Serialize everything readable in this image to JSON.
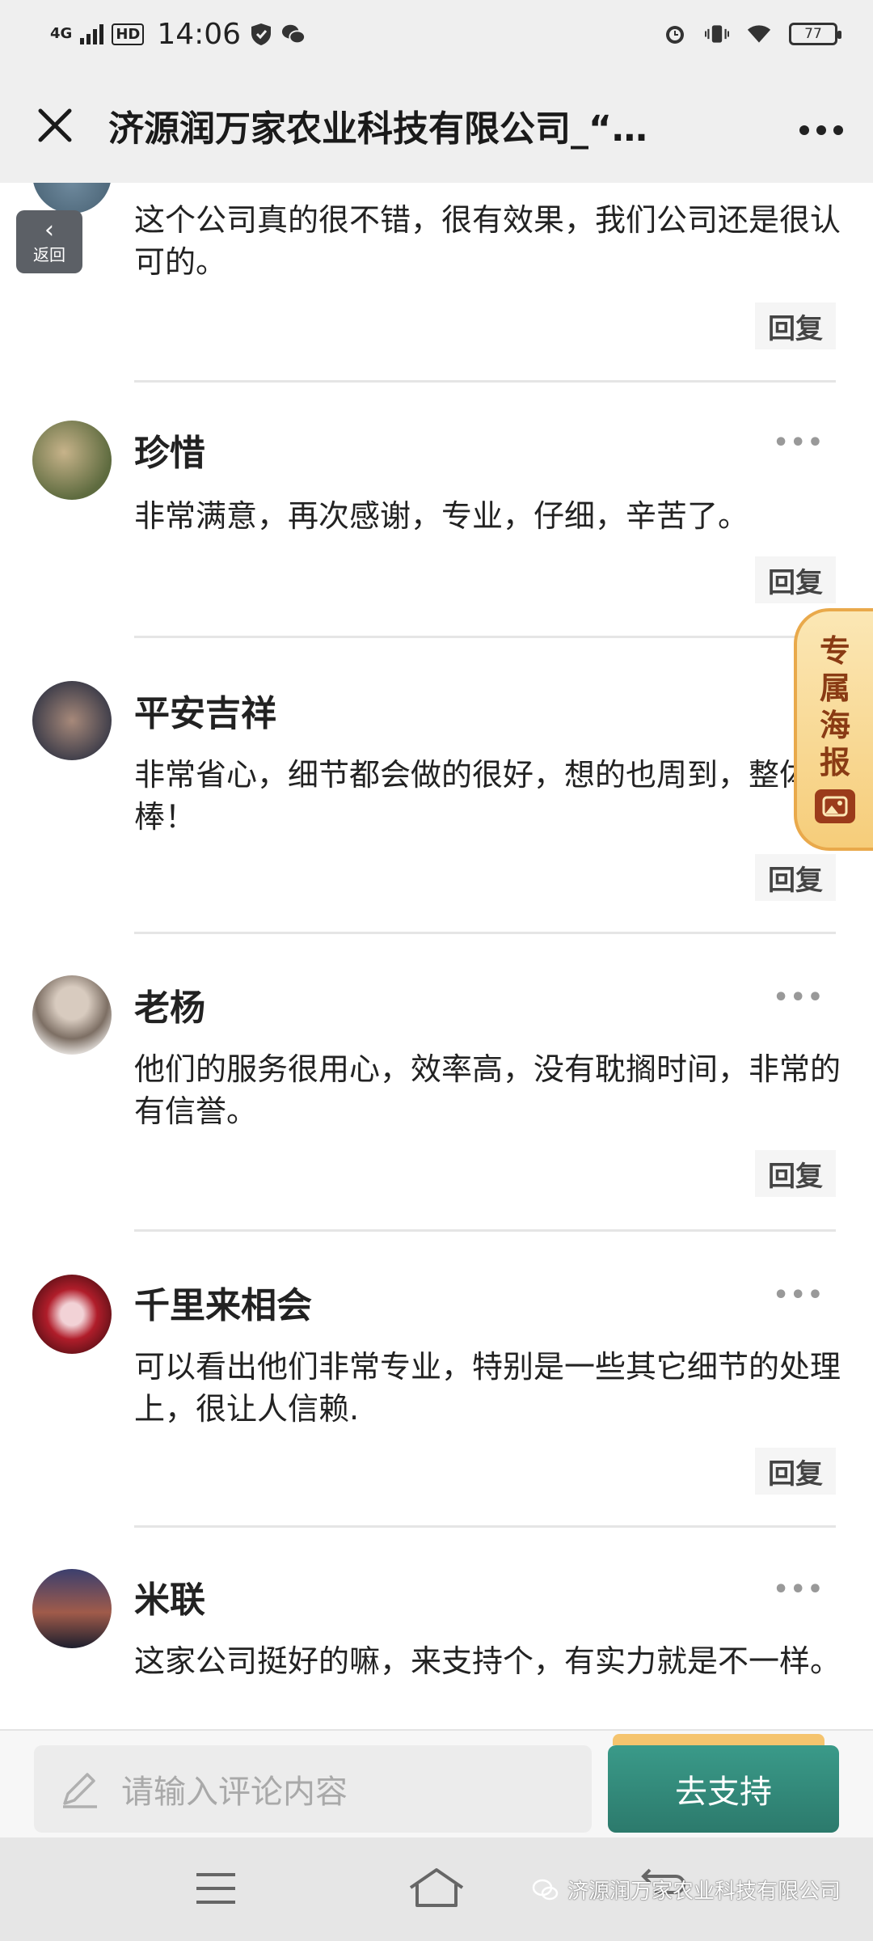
{
  "status_bar": {
    "network": "4G",
    "hd": "HD",
    "time": "14:06",
    "battery": "77"
  },
  "header": {
    "title": "济源润万家农业科技有限公司_“…"
  },
  "back_float": {
    "label": "返回"
  },
  "poster": {
    "label": "专属海报"
  },
  "comments": [
    {
      "name": "",
      "text": "这个公司真的很不错，很有效果，我们公司还是很认可的。",
      "reply": "回复"
    },
    {
      "name": "珍惜",
      "text": "非常满意，再次感谢，专业，仔细，辛苦了。",
      "reply": "回复"
    },
    {
      "name": "平安吉祥",
      "text": "非常省心，细节都会做的很好，想的也周到，整体很棒！",
      "reply": "回复"
    },
    {
      "name": "老杨",
      "text": "他们的服务很用心，效率高，没有耽搁时间，非常的有信誉。",
      "reply": "回复"
    },
    {
      "name": "千里来相会",
      "text": "可以看出他们非常专业，特别是一些其它细节的处理上，很让人信赖.",
      "reply": "回复"
    },
    {
      "name": "米联",
      "text": "这家公司挺好的嘛，来支持个，有实力就是不一样。",
      "reply": ""
    }
  ],
  "bottom_bar": {
    "input_placeholder": "请输入评论内容",
    "support_label": "去支持"
  },
  "watermark": "济源润万家农业科技有限公司",
  "colors": {
    "accent_green": "#2f8072",
    "poster_gold": "#f6cd7a",
    "poster_text": "#8a3b14"
  }
}
